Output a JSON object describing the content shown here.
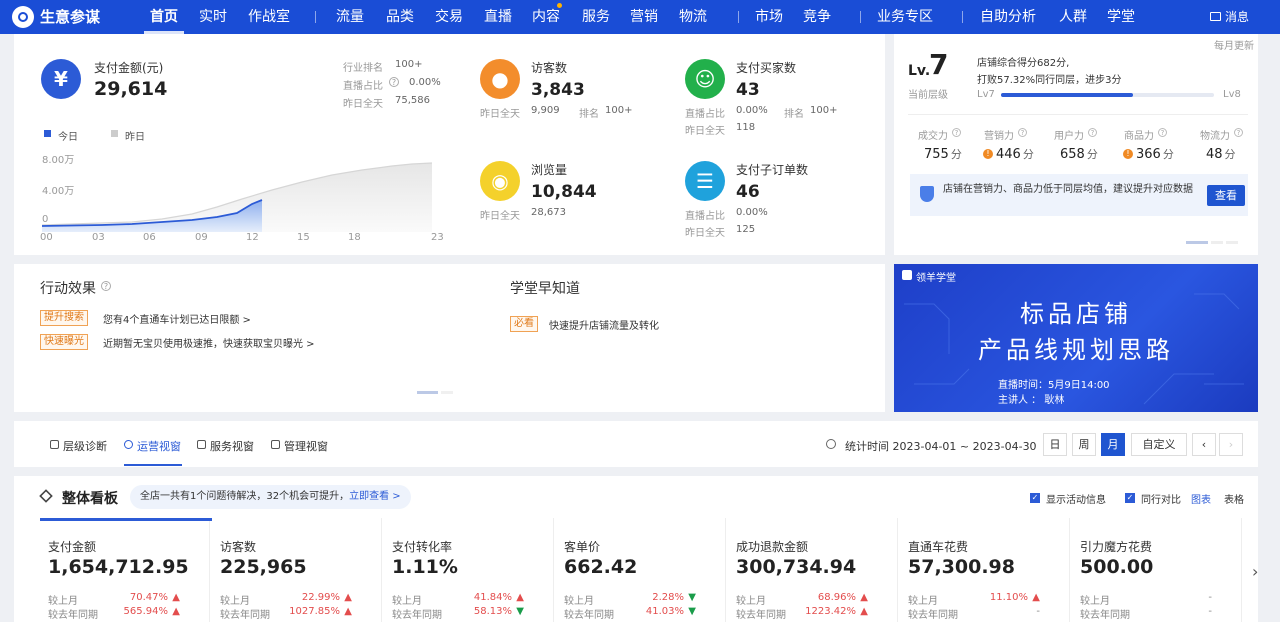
{
  "app": {
    "title": "生意参谋",
    "logo_icon": "compass-logo-icon"
  },
  "nav": {
    "items": [
      "首页",
      "实时",
      "作战室",
      "流量",
      "品类",
      "交易",
      "直播",
      "内容",
      "服务",
      "营销",
      "物流",
      "市场",
      "竞争",
      "业务专区",
      "自助分析",
      "人群",
      "学堂"
    ],
    "active": "首页",
    "message": "消息"
  },
  "overview": {
    "pay": {
      "label": "支付金额(元)",
      "value": "29,614",
      "rank_label": "行业排名",
      "rank": "100+",
      "live_label": "直播占比",
      "live": "0.00%",
      "yday_label": "昨日全天",
      "yday": "75,586"
    },
    "legend": {
      "today": "今日",
      "yesterday": "昨日"
    },
    "yticks": [
      "8.00万",
      "4.00万",
      "0"
    ],
    "xticks": [
      "00",
      "03",
      "06",
      "09",
      "12",
      "15",
      "18",
      "23"
    ],
    "visitors": {
      "label": "访客数",
      "value": "3,843",
      "yday_label": "昨日全天",
      "yday": "9,909",
      "rank_label": "排名",
      "rank": "100+"
    },
    "buyers": {
      "label": "支付买家数",
      "value": "43",
      "live_label": "直播占比",
      "live": "0.00%",
      "rank_label": "排名",
      "rank": "100+",
      "yday_label": "昨日全天",
      "yday": "118"
    },
    "pv": {
      "label": "浏览量",
      "value": "10,844",
      "yday_label": "昨日全天",
      "yday": "28,673"
    },
    "suborders": {
      "label": "支付子订单数",
      "value": "46",
      "live_label": "直播占比",
      "live": "0.00%",
      "yday_label": "昨日全天",
      "yday": "125"
    }
  },
  "level": {
    "update": "每月更新",
    "lv_prefix": "Lv.",
    "lv": "7",
    "lv_label": "当前层级",
    "desc1": "店铺综合得分682分,",
    "desc2": "打败57.32%同行同层，进步3分",
    "from": "Lv7",
    "to": "Lv8",
    "progress": 0.62,
    "scores": [
      {
        "label": "成交力",
        "value": "755",
        "unit": "分",
        "warn": false
      },
      {
        "label": "营销力",
        "value": "446",
        "unit": "分",
        "warn": true
      },
      {
        "label": "用户力",
        "value": "658",
        "unit": "分",
        "warn": false
      },
      {
        "label": "商品力",
        "value": "366",
        "unit": "分",
        "warn": true
      },
      {
        "label": "物流力",
        "value": "48",
        "unit": "分",
        "warn": false
      }
    ],
    "tip": "店铺在营销力、商品力低于同层均值，建议提升对应数据",
    "tip_button": "查看"
  },
  "action": {
    "title": "行动效果",
    "items": [
      {
        "tag": "提升搜索",
        "text": "您有4个直通车计划已达日限额 >"
      },
      {
        "tag": "快速曝光",
        "text": "近期暂无宝贝使用极速推，快速获取宝贝曝光 >"
      }
    ]
  },
  "school": {
    "title": "学堂早知道",
    "tag": "必看",
    "text": "快速提升店铺流量及转化"
  },
  "banner": {
    "brand": "领羊学堂",
    "line1": "标品店铺",
    "line2": "产品线规划思路",
    "line3": "直播时间：5月9日14:00",
    "line4": "主讲人 ：  耿林"
  },
  "tabs": {
    "items": [
      "层级诊断",
      "运营视窗",
      "服务视窗",
      "管理视窗"
    ],
    "active": "运营视窗",
    "period": "统计时间 2023-04-01 ~ 2023-04-30",
    "buttons": [
      "日",
      "周",
      "月",
      "自定义"
    ],
    "active_button": "月"
  },
  "board": {
    "title": "整体看板",
    "notice": "全店一共有1个问题待解决，32个机会可提升，",
    "notice_link": "立即查看 >",
    "opt1": "显示活动信息",
    "opt2": "同行对比",
    "view1": "图表",
    "view2": "表格"
  },
  "kpis": [
    {
      "label": "支付金额",
      "value": "1,654,712.95",
      "m_label": "较上月",
      "m": "70.47%",
      "m_dir": "up",
      "y_label": "较去年同期",
      "y": "565.94%",
      "y_dir": "up"
    },
    {
      "label": "访客数",
      "value": "225,965",
      "m_label": "较上月",
      "m": "22.99%",
      "m_dir": "up",
      "y_label": "较去年同期",
      "y": "1027.85%",
      "y_dir": "up"
    },
    {
      "label": "支付转化率",
      "value": "1.11%",
      "m_label": "较上月",
      "m": "41.84%",
      "m_dir": "up",
      "y_label": "较去年同期",
      "y": "58.13%",
      "y_dir": "down"
    },
    {
      "label": "客单价",
      "value": "662.42",
      "m_label": "较上月",
      "m": "2.28%",
      "m_dir": "down",
      "y_label": "较去年同期",
      "y": "41.03%",
      "y_dir": "down"
    },
    {
      "label": "成功退款金额",
      "value": "300,734.94",
      "m_label": "较上月",
      "m": "68.96%",
      "m_dir": "up",
      "y_label": "较去年同期",
      "y": "1223.42%",
      "y_dir": "up"
    },
    {
      "label": "直通车花费",
      "value": "57,300.98",
      "m_label": "较上月",
      "m": "11.10%",
      "m_dir": "up",
      "y_label": "较去年同期",
      "y": "-",
      "y_dir": "none"
    },
    {
      "label": "引力魔方花费",
      "value": "500.00",
      "m_label": "较上月",
      "m": "-",
      "m_dir": "none",
      "y_label": "较去年同期",
      "y": "-",
      "y_dir": "none"
    }
  ],
  "colors": {
    "nav": "#1a4dd6",
    "primary": "#2c5bd6",
    "up": "#e34d4d",
    "down": "#1a9c4a"
  }
}
